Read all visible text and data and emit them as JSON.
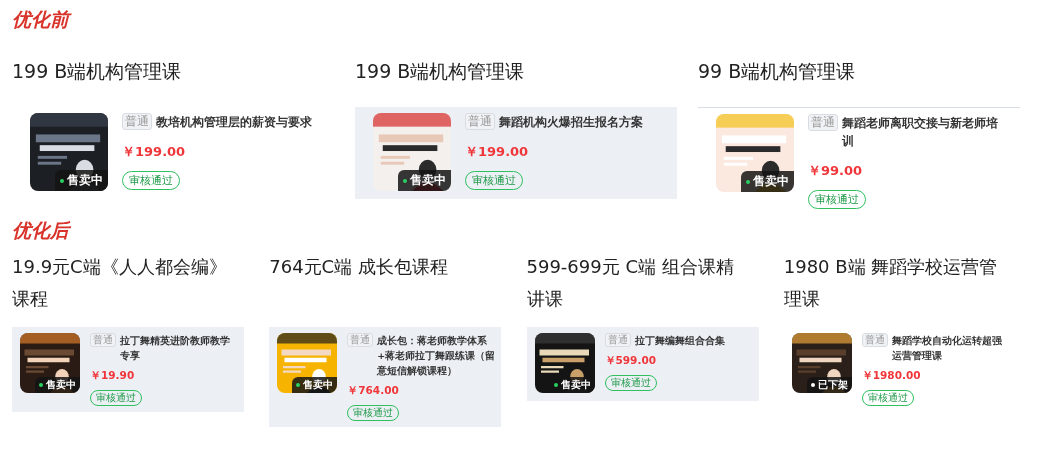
{
  "sections": [
    {
      "heading": "优化前",
      "items": [
        {
          "title": "199 B端机构管理课",
          "card": {
            "shaded": false,
            "top_rule": false,
            "tag": "普通",
            "name": "教培机构管理层的薪资与要求",
            "price": "￥199.00",
            "status_label": "售卖中",
            "on_sale": true,
            "review": "审核通过"
          }
        },
        {
          "title": "199 B端机构管理课",
          "card": {
            "shaded": true,
            "top_rule": false,
            "tag": "普通",
            "name": "舞蹈机构火爆招生报名方案",
            "price": "￥199.00",
            "status_label": "售卖中",
            "on_sale": true,
            "review": "审核通过"
          }
        },
        {
          "title": "99 B端机构管理课",
          "card": {
            "shaded": false,
            "top_rule": true,
            "tag": "普通",
            "name": "舞蹈老师离职交接与新老师培训",
            "price": "￥99.00",
            "status_label": "售卖中",
            "on_sale": true,
            "review": "审核通过"
          }
        }
      ]
    },
    {
      "heading": "优化后",
      "items": [
        {
          "title": "19.9元C端《人人都会编》课程",
          "card": {
            "shaded": true,
            "top_rule": false,
            "tag": "普通",
            "name": "拉丁舞精英进阶教师教学专享",
            "price": "￥19.90",
            "status_label": "售卖中",
            "on_sale": true,
            "review": "审核通过"
          }
        },
        {
          "title": "764元C端 成长包课程",
          "card": {
            "shaded": true,
            "top_rule": false,
            "tag": "普通",
            "name": "成长包：蒋老师教学体系+蒋老师拉丁舞跟练课（留意短信解锁课程）",
            "price": "￥764.00",
            "status_label": "售卖中",
            "on_sale": true,
            "review": "审核通过"
          }
        },
        {
          "title": "599-699元 C端 组合课精讲课",
          "card": {
            "shaded": true,
            "top_rule": false,
            "tag": "普通",
            "name": "拉丁舞编舞组合合集",
            "price": "￥599.00",
            "status_label": "售卖中",
            "on_sale": true,
            "review": "审核通过"
          }
        },
        {
          "title": "1980 B端  舞蹈学校运营管理课",
          "card": {
            "shaded": false,
            "top_rule": false,
            "tag": "普通",
            "name": "舞蹈学校自动化运转超强运营管理课",
            "price": "￥1980.00",
            "status_label": "已下架",
            "on_sale": false,
            "review": "审核通过"
          }
        }
      ]
    }
  ]
}
